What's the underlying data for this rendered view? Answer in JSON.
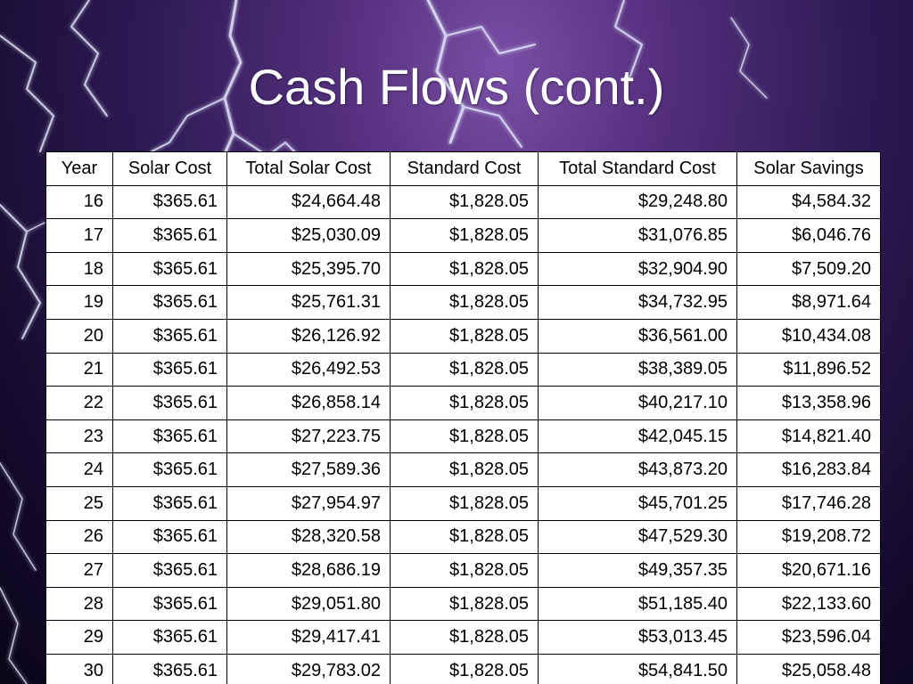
{
  "slide": {
    "title": "Cash Flows (cont.)"
  },
  "colors": {
    "background_dark": "#140a2c",
    "background_glow": "#7a4fa6",
    "lightning": "#e6ecff",
    "table_bg": "#ffffff",
    "table_border": "#000000",
    "title_text": "#ffffff"
  },
  "table": {
    "headers": [
      "Year",
      "Solar Cost",
      "Total Solar Cost",
      "Standard Cost",
      "Total Standard Cost",
      "Solar Savings"
    ],
    "rows": [
      [
        "16",
        "$365.61",
        "$24,664.48",
        "$1,828.05",
        "$29,248.80",
        "$4,584.32"
      ],
      [
        "17",
        "$365.61",
        "$25,030.09",
        "$1,828.05",
        "$31,076.85",
        "$6,046.76"
      ],
      [
        "18",
        "$365.61",
        "$25,395.70",
        "$1,828.05",
        "$32,904.90",
        "$7,509.20"
      ],
      [
        "19",
        "$365.61",
        "$25,761.31",
        "$1,828.05",
        "$34,732.95",
        "$8,971.64"
      ],
      [
        "20",
        "$365.61",
        "$26,126.92",
        "$1,828.05",
        "$36,561.00",
        "$10,434.08"
      ],
      [
        "21",
        "$365.61",
        "$26,492.53",
        "$1,828.05",
        "$38,389.05",
        "$11,896.52"
      ],
      [
        "22",
        "$365.61",
        "$26,858.14",
        "$1,828.05",
        "$40,217.10",
        "$13,358.96"
      ],
      [
        "23",
        "$365.61",
        "$27,223.75",
        "$1,828.05",
        "$42,045.15",
        "$14,821.40"
      ],
      [
        "24",
        "$365.61",
        "$27,589.36",
        "$1,828.05",
        "$43,873.20",
        "$16,283.84"
      ],
      [
        "25",
        "$365.61",
        "$27,954.97",
        "$1,828.05",
        "$45,701.25",
        "$17,746.28"
      ],
      [
        "26",
        "$365.61",
        "$28,320.58",
        "$1,828.05",
        "$47,529.30",
        "$19,208.72"
      ],
      [
        "27",
        "$365.61",
        "$28,686.19",
        "$1,828.05",
        "$49,357.35",
        "$20,671.16"
      ],
      [
        "28",
        "$365.61",
        "$29,051.80",
        "$1,828.05",
        "$51,185.40",
        "$22,133.60"
      ],
      [
        "29",
        "$365.61",
        "$29,417.41",
        "$1,828.05",
        "$53,013.45",
        "$23,596.04"
      ],
      [
        "30",
        "$365.61",
        "$29,783.02",
        "$1,828.05",
        "$54,841.50",
        "$25,058.48"
      ]
    ]
  }
}
